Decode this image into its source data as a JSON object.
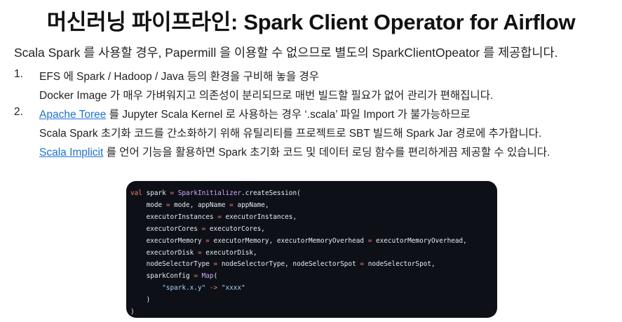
{
  "title": "머신러닝 파이프라인: Spark Client Operator for Airflow",
  "subtitle": "Scala Spark 를 사용할 경우, Papermill 을 이용할 수 없으므로 별도의 SparkClientOpeator 를 제공합니다.",
  "items": [
    {
      "number": "1.",
      "lines": [
        {
          "text": "EFS 에 Spark / Hadoop / Java 등의 환경을 구비해 놓을 경우"
        },
        {
          "text": "Docker Image 가 매우 가벼워지고 의존성이 분리되므로 매번 빌드할 필요가 없어 관리가 편해집니다."
        }
      ]
    },
    {
      "number": "2.",
      "lines": [
        {
          "link": "Apache Toree",
          "text": " 를 Jupyter Scala Kernel 로 사용하는 경우 ‘.scala’ 파일 Import 가 불가능하므로"
        },
        {
          "text": "Scala Spark 초기화 코드를 간소화하기 위해 유틸리티를 프로젝트로 SBT 빌드해 Spark Jar 경로에 추가합니다."
        },
        {
          "link": "Scala Implicit",
          "text": " 를 언어 기능을 활용하면 Spark 초기화 코드 및 데이터 로딩 함수를 편리하게끔 제공할 수 있습니다."
        }
      ]
    }
  ],
  "code": [
    [
      [
        "val",
        "kw"
      ],
      [
        " spark ",
        "id"
      ],
      [
        "=",
        "op"
      ],
      [
        " ",
        "id"
      ],
      [
        "SparkInitializer",
        "fn"
      ],
      [
        ".createSession(",
        "id"
      ]
    ],
    [
      [
        "    mode ",
        "id"
      ],
      [
        "=",
        "op"
      ],
      [
        " mode, appName ",
        "id"
      ],
      [
        "=",
        "op"
      ],
      [
        " appName,",
        "id"
      ]
    ],
    [
      [
        "    executorInstances ",
        "id"
      ],
      [
        "=",
        "op"
      ],
      [
        " executorInstances,",
        "id"
      ]
    ],
    [
      [
        "    executorCores ",
        "id"
      ],
      [
        "=",
        "op"
      ],
      [
        " executorCores,",
        "id"
      ]
    ],
    [
      [
        "    executorMemory ",
        "id"
      ],
      [
        "=",
        "op"
      ],
      [
        " executorMemory, executorMemoryOverhead ",
        "id"
      ],
      [
        "=",
        "op"
      ],
      [
        " executorMemoryOverhead,",
        "id"
      ]
    ],
    [
      [
        "    executorDisk ",
        "id"
      ],
      [
        "=",
        "op"
      ],
      [
        " executorDisk,",
        "id"
      ]
    ],
    [
      [
        "    nodeSelectorType ",
        "id"
      ],
      [
        "=",
        "op"
      ],
      [
        " nodeSelectorType, nodeSelectorSpot ",
        "id"
      ],
      [
        "=",
        "op"
      ],
      [
        " nodeSelectorSpot,",
        "id"
      ]
    ],
    [
      [
        "    sparkConfig ",
        "id"
      ],
      [
        "=",
        "op"
      ],
      [
        " ",
        "id"
      ],
      [
        "Map",
        "fn"
      ],
      [
        "(",
        "id"
      ]
    ],
    [
      [
        "        ",
        "id"
      ],
      [
        "\"spark.x.y\"",
        "str"
      ],
      [
        " ",
        "id"
      ],
      [
        "->",
        "op"
      ],
      [
        " ",
        "id"
      ],
      [
        "\"xxxx\"",
        "str"
      ]
    ],
    [
      [
        "    )",
        "id"
      ]
    ],
    [
      [
        ")",
        "id"
      ]
    ]
  ]
}
